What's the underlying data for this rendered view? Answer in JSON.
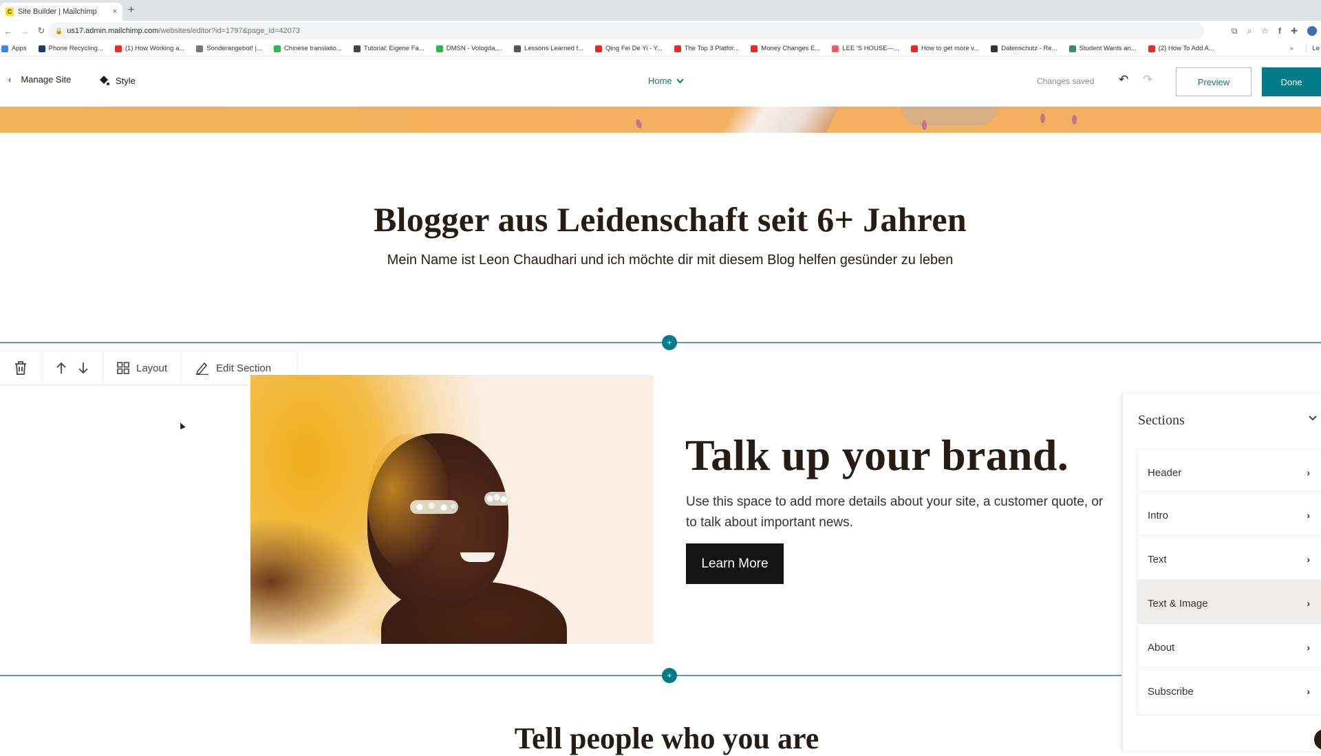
{
  "browser": {
    "tab_title": "Site Builder | Mailchimp",
    "tab_close": "×",
    "new_tab": "+",
    "url_host": "us17.admin.mailchimp.com",
    "url_path": "/websites/editor?id=1797&page_id=42073",
    "bookmarks": [
      {
        "label": "Apps",
        "color": "#4285f4"
      },
      {
        "label": "Phone Recycling...",
        "color": "#1e3c72"
      },
      {
        "label": "(1) How Working a...",
        "color": "#e52d27"
      },
      {
        "label": "Sonderangebot! |...",
        "color": "#777777"
      },
      {
        "label": "Chinese translatio...",
        "color": "#2db84d"
      },
      {
        "label": "Tutorial: Eigene Fa...",
        "color": "#444444"
      },
      {
        "label": "DMSN - Vologda,...",
        "color": "#2db84d"
      },
      {
        "label": "Lessons Learned f...",
        "color": "#555555"
      },
      {
        "label": "Qing Fei De Yi - Y...",
        "color": "#e52d27"
      },
      {
        "label": "The Top 3 Platfor...",
        "color": "#e52d27"
      },
      {
        "label": "Money Changes E...",
        "color": "#e52d27"
      },
      {
        "label": "LEE 'S HOUSE—...",
        "color": "#ff5a5f"
      },
      {
        "label": "How to get more v...",
        "color": "#e52d27"
      },
      {
        "label": "Datenschutz - Re...",
        "color": "#333333"
      },
      {
        "label": "Student Wants an...",
        "color": "#3a8a6a"
      },
      {
        "label": "(2) How To Add A...",
        "color": "#e52d27"
      }
    ],
    "bookmarks_overflow": "»",
    "reading_list": "Le"
  },
  "header": {
    "manage_site": "Manage Site",
    "style": "Style",
    "page_selector": "Home",
    "status": "Changes saved",
    "preview": "Preview",
    "done": "Done"
  },
  "colors": {
    "accent": "#007c89",
    "divider": "#5e9ea3",
    "button_dark": "#141414",
    "active_section": "#efeeec"
  },
  "intro": {
    "title": "Blogger aus Leidenschaft seit 6+ Jahren",
    "subtitle": "Mein Name ist Leon Chaudhari und ich möchte dir mit diesem Blog helfen gesünder zu leben"
  },
  "section_toolbar": {
    "layout": "Layout",
    "edit_section": "Edit Section"
  },
  "text_image": {
    "title": "Talk up your brand.",
    "body": "Use this space to add more details about your site, a customer quote, or to talk about important news.",
    "button": "Learn More"
  },
  "next_section": {
    "title": "Tell people who you are"
  },
  "sections_panel": {
    "title": "Sections",
    "items": [
      {
        "label": "Header",
        "active": false
      },
      {
        "label": "Intro",
        "active": false
      },
      {
        "label": "Text",
        "active": false
      },
      {
        "label": "Text & Image",
        "active": true
      },
      {
        "label": "About",
        "active": false
      },
      {
        "label": "Subscribe",
        "active": false
      }
    ]
  }
}
